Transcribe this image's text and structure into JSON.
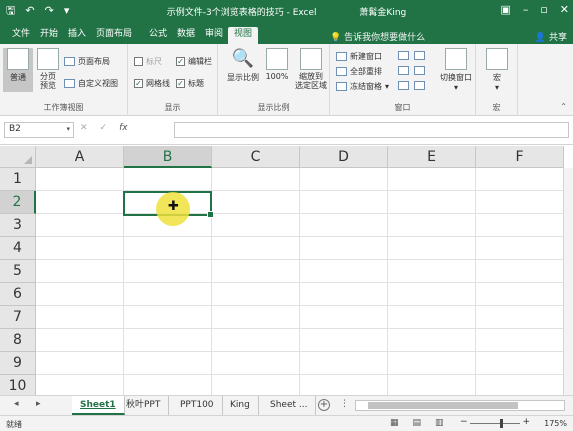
{
  "window": {
    "title": "示例文件-3个浏览表格的技巧 - Excel",
    "user": "萧髯金King",
    "qat": {
      "save_icon": "save-icon",
      "undo_icon": "undo-icon",
      "redo_icon": "redo-icon"
    }
  },
  "tabs": {
    "items": [
      "文件",
      "开始",
      "插入",
      "页面布局",
      "公式",
      "数据",
      "审阅",
      "视图"
    ],
    "active": "视图",
    "tell_me": "告诉我你想要做什么",
    "share": "共享"
  },
  "ribbon": {
    "workbook_views": {
      "label": "工作簿视图",
      "normal": "普通",
      "page_break": "分页\n预览",
      "page_layout": "页面布局",
      "custom_views": "自定义视图"
    },
    "show": {
      "label": "显示",
      "ruler": "标尺",
      "gridlines": "网格线",
      "formula_bar": "编辑栏",
      "headings": "标题",
      "ruler_checked": false,
      "gridlines_checked": true,
      "formula_bar_checked": true,
      "headings_checked": true
    },
    "zoom": {
      "label": "显示比例",
      "zoom_btn": "显示比例",
      "hundred": "100%",
      "zoom_selection": "缩放到\n选定区域"
    },
    "window": {
      "label": "窗口",
      "new_window": "新建窗口",
      "arrange_all": "全部重排",
      "freeze_panes": "冻结窗格",
      "switch_windows": "切换窗口"
    },
    "macros": {
      "label": "宏",
      "macro": "宏"
    }
  },
  "formula_bar": {
    "name_box": "B2",
    "cancel": "✕",
    "enter": "✓",
    "fx": "fx",
    "content": ""
  },
  "grid": {
    "columns": [
      "A",
      "B",
      "C",
      "D",
      "E",
      "F"
    ],
    "rows": [
      "1",
      "2",
      "3",
      "4",
      "5",
      "6",
      "7",
      "8",
      "9",
      "10"
    ],
    "selected_column": "B",
    "selected_row": "2"
  },
  "sheets": {
    "tabs": [
      "Sheet1",
      "秋叶PPT",
      "PPT100",
      "King",
      "Sheet ..."
    ],
    "active": "Sheet1",
    "add": "⊕"
  },
  "status": {
    "ready": "就绪",
    "zoom_percent": "175%"
  }
}
